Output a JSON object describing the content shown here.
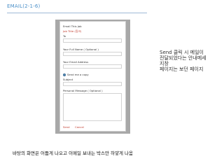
{
  "header": {
    "title": "EMAIL(2-1-6)"
  },
  "dialog": {
    "title": "Email This Job",
    "job_title_link": "Job Title (링크)",
    "to_label": "To",
    "full_name_label": "Your Full Name ( Optional )",
    "email_label": "Your Email Address",
    "copy_option_label": "Send me a copy",
    "subject_label": "Subject",
    "message_label": "Personal Message ( Optional )",
    "send_label": "Send",
    "cancel_label": "Cancel"
  },
  "notice": {
    "line1": "Send 클릭 시 메일이",
    "line2": "전달되었다는 안내메세",
    "line3": "지창",
    "line4": "페이지는 보던 페이지"
  },
  "caption": "바탕의 화면은 어둡게 나오고 이메일 보내는 박스만 하얗게 나옴"
}
